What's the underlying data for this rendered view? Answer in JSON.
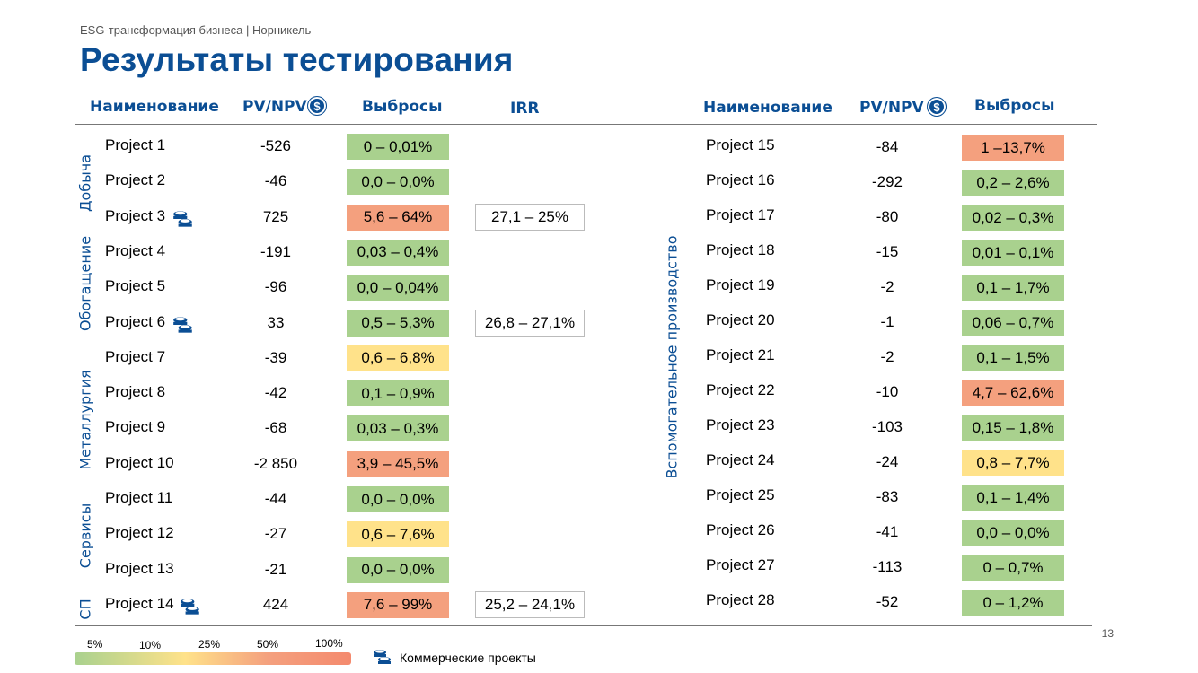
{
  "header": {
    "subtitle": "ESG-трансформация бизнеса | Норникель",
    "title": "Результаты тестирования"
  },
  "columns": {
    "name": "Наименование",
    "npv": "PV/NPV",
    "emissions": "Выбросы",
    "irr": "IRR"
  },
  "groups": [
    "Добыча",
    "Обогащение",
    "Металлургия",
    "Сервисы",
    "СП",
    "Вспомогательное производство"
  ],
  "left_rows": [
    {
      "name": "Project 1",
      "npv": "-526",
      "em": "0 – 0,01%",
      "color": "green",
      "irr": "",
      "commercial": false
    },
    {
      "name": "Project 2",
      "npv": "-46",
      "em": "0,0 – 0,0%",
      "color": "green",
      "irr": "",
      "commercial": false
    },
    {
      "name": "Project 3",
      "npv": "725",
      "em": "5,6 – 64%",
      "color": "red",
      "irr": "27,1 – 25%",
      "commercial": true
    },
    {
      "name": "Project 4",
      "npv": "-191",
      "em": "0,03 – 0,4%",
      "color": "green",
      "irr": "",
      "commercial": false
    },
    {
      "name": "Project 5",
      "npv": "-96",
      "em": "0,0 – 0,04%",
      "color": "green",
      "irr": "",
      "commercial": false
    },
    {
      "name": "Project 6",
      "npv": "33",
      "em": "0,5 – 5,3%",
      "color": "green",
      "irr": "26,8 – 27,1%",
      "commercial": true
    },
    {
      "name": "Project 7",
      "npv": "-39",
      "em": "0,6 – 6,8%",
      "color": "yellow",
      "irr": "",
      "commercial": false
    },
    {
      "name": "Project 8",
      "npv": "-42",
      "em": "0,1 – 0,9%",
      "color": "green",
      "irr": "",
      "commercial": false
    },
    {
      "name": "Project 9",
      "npv": "-68",
      "em": "0,03 – 0,3%",
      "color": "green",
      "irr": "",
      "commercial": false
    },
    {
      "name": "Project 10",
      "npv": "-2 850",
      "em": "3,9 – 45,5%",
      "color": "red",
      "irr": "",
      "commercial": false
    },
    {
      "name": "Project 11",
      "npv": "-44",
      "em": "0,0 – 0,0%",
      "color": "green",
      "irr": "",
      "commercial": false
    },
    {
      "name": "Project 12",
      "npv": "-27",
      "em": "0,6 – 7,6%",
      "color": "yellow",
      "irr": "",
      "commercial": false
    },
    {
      "name": "Project 13",
      "npv": "-21",
      "em": "0,0 – 0,0%",
      "color": "green",
      "irr": "",
      "commercial": false
    },
    {
      "name": "Project 14",
      "npv": "424",
      "em": "7,6 – 99%",
      "color": "red",
      "irr": "25,2 – 24,1%",
      "commercial": true
    }
  ],
  "right_rows": [
    {
      "name": "Project 15",
      "npv": "-84",
      "em": "1 –13,7%",
      "color": "red"
    },
    {
      "name": "Project 16",
      "npv": "-292",
      "em": "0,2 – 2,6%",
      "color": "green"
    },
    {
      "name": "Project 17",
      "npv": "-80",
      "em": "0,02 – 0,3%",
      "color": "green"
    },
    {
      "name": "Project 18",
      "npv": "-15",
      "em": "0,01 – 0,1%",
      "color": "green"
    },
    {
      "name": "Project 19",
      "npv": "-2",
      "em": "0,1 – 1,7%",
      "color": "green"
    },
    {
      "name": "Project 20",
      "npv": "-1",
      "em": "0,06 – 0,7%",
      "color": "green"
    },
    {
      "name": "Project 21",
      "npv": "-2",
      "em": "0,1 – 1,5%",
      "color": "green"
    },
    {
      "name": "Project 22",
      "npv": "-10",
      "em": "4,7 – 62,6%",
      "color": "red"
    },
    {
      "name": "Project 23",
      "npv": "-103",
      "em": "0,15 – 1,8%",
      "color": "green"
    },
    {
      "name": "Project 24",
      "npv": "-24",
      "em": "0,8 – 7,7%",
      "color": "yellow"
    },
    {
      "name": "Project 25",
      "npv": "-83",
      "em": "0,1 – 1,4%",
      "color": "green"
    },
    {
      "name": "Project 26",
      "npv": "-41",
      "em": "0,0 – 0,0%",
      "color": "green"
    },
    {
      "name": "Project 27",
      "npv": "-113",
      "em": "0 – 0,7%",
      "color": "green"
    },
    {
      "name": "Project 28",
      "npv": "-52",
      "em": "0 – 1,2%",
      "color": "green"
    }
  ],
  "legend": {
    "ticks": [
      "5%",
      "10%",
      "25%",
      "50%",
      "100%"
    ],
    "commercial_label": "Коммерческие проекты"
  },
  "page_number": "13",
  "colors": {
    "green": "#a9d18e",
    "yellow": "#ffe28a",
    "red": "#f4a07e",
    "brand": "#0b4e94"
  },
  "icons": {
    "npv": "dollar-coin-icon",
    "commercial": "coin-stack-icon"
  }
}
